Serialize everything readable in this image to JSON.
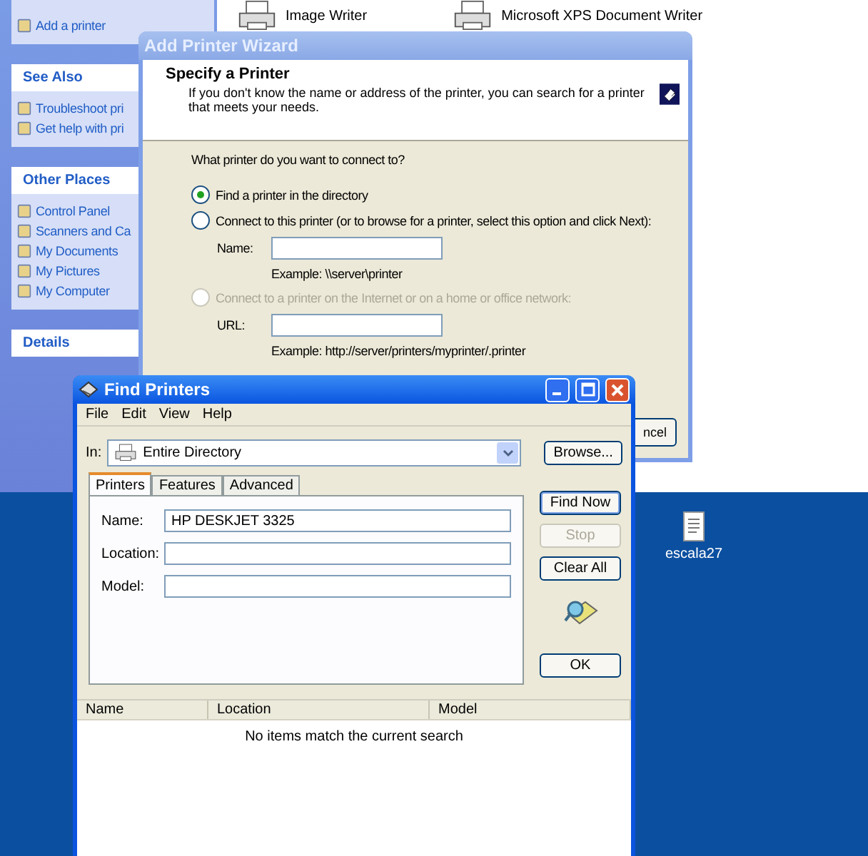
{
  "explorer": {
    "sidebar_panels": [
      {
        "items": [
          "Add a printer"
        ]
      },
      {
        "title": "See Also",
        "items": [
          "Troubleshoot pri",
          "Get help with pri"
        ]
      },
      {
        "title": "Other Places",
        "items": [
          "Control Panel",
          "Scanners and Ca",
          "My Documents",
          "My Pictures",
          "My Computer"
        ]
      },
      {
        "title": "Details"
      }
    ],
    "printers": [
      "Image Writer",
      "Microsoft XPS Document Writer"
    ]
  },
  "wizard": {
    "title": "Add Printer Wizard",
    "heading": "Specify a Printer",
    "description": "If you don't know the name or address of the printer, you can search for a printer that meets your needs.",
    "question": "What printer do you want to connect to?",
    "options": [
      {
        "label": "Find a printer in the directory",
        "selected": true,
        "disabled": false
      },
      {
        "label": "Connect to this printer (or to browse for a printer, select this option and click Next):",
        "selected": false,
        "disabled": false,
        "field_label": "Name:",
        "example": "Example: \\\\server\\printer"
      },
      {
        "label": "Connect to a printer on the Internet or on a home or office network:",
        "selected": false,
        "disabled": true,
        "field_label": "URL:",
        "example": "Example: http://server/printers/myprinter/.printer"
      }
    ],
    "cancel_button": "ncel"
  },
  "find_printers": {
    "title": "Find Printers",
    "menu": [
      "File",
      "Edit",
      "View",
      "Help"
    ],
    "in_label": "In:",
    "in_value": "Entire Directory",
    "browse_button": "Browse...",
    "tabs": [
      {
        "label": "Printers",
        "selected": true
      },
      {
        "label": "Features",
        "selected": false
      },
      {
        "label": "Advanced",
        "selected": false
      }
    ],
    "fields": [
      {
        "label": "Name:",
        "value": "HP DESKJET 3325"
      },
      {
        "label": "Location:"
      },
      {
        "label": "Model:"
      }
    ],
    "buttons": [
      {
        "label": "Find Now",
        "disabled": false
      },
      {
        "label": "Stop",
        "disabled": true
      },
      {
        "label": "Clear All",
        "disabled": false
      }
    ],
    "ok_button": "OK",
    "columns": [
      "Name",
      "Location",
      "Model"
    ],
    "empty_message": "No items match the current search"
  },
  "desktop_icons": [
    "escala27"
  ]
}
